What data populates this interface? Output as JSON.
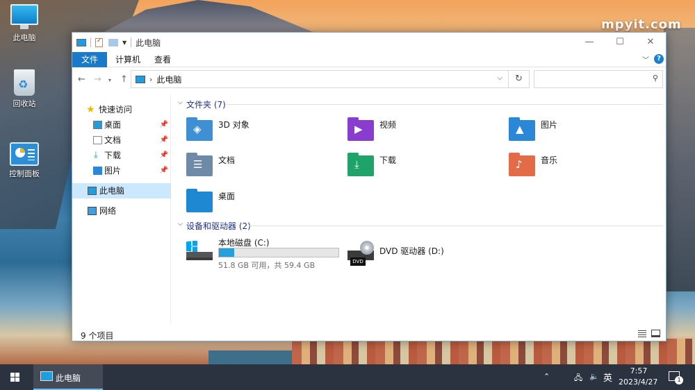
{
  "watermark": "mpyit.com",
  "desktop": {
    "icons": [
      {
        "label": "此电脑",
        "icon": "this-pc-icon"
      },
      {
        "label": "回收站",
        "icon": "recycle-bin-icon"
      },
      {
        "label": "控制面板",
        "icon": "control-panel-icon"
      }
    ]
  },
  "window": {
    "title": "此电脑",
    "controls": {
      "minimize": "—",
      "maximize": "☐",
      "close": "✕"
    },
    "ribbon": {
      "tabs": [
        "文件",
        "计算机",
        "查看"
      ],
      "help": "?"
    },
    "address": {
      "path": "此电脑",
      "separator": "›"
    },
    "search": {
      "placeholder": ""
    },
    "nav_pane": {
      "quick_access": "快速访问",
      "items": [
        {
          "label": "桌面",
          "pinned": true
        },
        {
          "label": "文档",
          "pinned": true
        },
        {
          "label": "下载",
          "pinned": true
        },
        {
          "label": "图片",
          "pinned": true
        }
      ],
      "this_pc": "此电脑",
      "network": "网络"
    },
    "folders_header": "文件夹 (7)",
    "folders": [
      {
        "label": "3D 对象",
        "icon": "3d-objects-icon",
        "color": "#3f8fd4"
      },
      {
        "label": "视频",
        "icon": "videos-icon",
        "color": "#8a3ccf"
      },
      {
        "label": "图片",
        "icon": "pictures-icon",
        "color": "#2b88d9"
      },
      {
        "label": "文档",
        "icon": "documents-icon",
        "color": "#6f8aa8"
      },
      {
        "label": "下载",
        "icon": "downloads-icon",
        "color": "#1fa36a"
      },
      {
        "label": "音乐",
        "icon": "music-icon",
        "color": "#e46b48"
      },
      {
        "label": "桌面",
        "icon": "desktop-icon",
        "color": "#1e88d2"
      }
    ],
    "devices_header": "设备和驱动器 (2)",
    "drives": {
      "c": {
        "name": "本地磁盘 (C:)",
        "free_text": "51.8 GB 可用，共 59.4 GB",
        "used_fraction": 0.128
      },
      "d": {
        "name": "DVD 驱动器 (D:)",
        "badge": "DVD"
      }
    },
    "status": {
      "count": "9 个项目"
    }
  },
  "taskbar": {
    "app_label": "此电脑",
    "ime": "英",
    "time": "7:57",
    "date": "2023/4/27",
    "notifications": "1"
  }
}
